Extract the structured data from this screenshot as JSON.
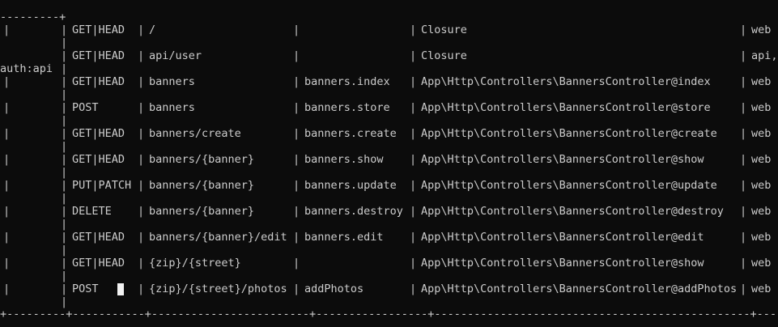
{
  "terminal": {
    "border_top": "---------+",
    "border_bottom": "+---------+-----------+------------------------+-----------------+------------------------------------------------+-----------",
    "separator": "|",
    "rows": [
      {
        "method": "GET|HEAD",
        "uri": "/",
        "name": "",
        "action": "Closure",
        "middleware": "web",
        "wrap": ""
      },
      {
        "method": "GET|HEAD",
        "uri": "api/user",
        "name": "",
        "action": "Closure",
        "middleware": "api,",
        "wrap": "auth:api"
      },
      {
        "method": "GET|HEAD",
        "uri": "banners",
        "name": "banners.index",
        "action": "App\\Http\\Controllers\\BannersController@index",
        "middleware": "web",
        "wrap": ""
      },
      {
        "method": "POST",
        "uri": "banners",
        "name": "banners.store",
        "action": "App\\Http\\Controllers\\BannersController@store",
        "middleware": "web",
        "wrap": ""
      },
      {
        "method": "GET|HEAD",
        "uri": "banners/create",
        "name": "banners.create",
        "action": "App\\Http\\Controllers\\BannersController@create",
        "middleware": "web",
        "wrap": ""
      },
      {
        "method": "GET|HEAD",
        "uri": "banners/{banner}",
        "name": "banners.show",
        "action": "App\\Http\\Controllers\\BannersController@show",
        "middleware": "web",
        "wrap": ""
      },
      {
        "method": "PUT|PATCH",
        "uri": "banners/{banner}",
        "name": "banners.update",
        "action": "App\\Http\\Controllers\\BannersController@update",
        "middleware": "web",
        "wrap": ""
      },
      {
        "method": "DELETE",
        "uri": "banners/{banner}",
        "name": "banners.destroy",
        "action": "App\\Http\\Controllers\\BannersController@destroy",
        "middleware": "web",
        "wrap": ""
      },
      {
        "method": "GET|HEAD",
        "uri": "banners/{banner}/edit",
        "name": "banners.edit",
        "action": "App\\Http\\Controllers\\BannersController@edit",
        "middleware": "web",
        "wrap": ""
      },
      {
        "method": "GET|HEAD",
        "uri": "{zip}/{street}",
        "name": "",
        "action": "App\\Http\\Controllers\\BannersController@show",
        "middleware": "web",
        "wrap": ""
      },
      {
        "method": "POST",
        "uri": "{zip}/{street}/photos",
        "name": "addPhotos",
        "action": "App\\Http\\Controllers\\BannersController@addPhotos",
        "middleware": "web",
        "wrap": ""
      }
    ]
  },
  "colors": {
    "background": "#0c0c0c",
    "text": "#cccccc",
    "cursor": "#f2f2f2"
  }
}
